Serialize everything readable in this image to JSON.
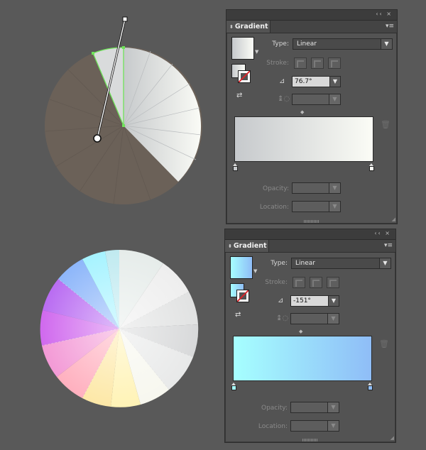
{
  "panels": [
    {
      "title": "Gradient",
      "type_label": "Type:",
      "type_value": "Linear",
      "stroke_label": "Stroke:",
      "angle_value": "76.7°",
      "opacity_label": "Opacity:",
      "location_label": "Location:",
      "colors": {
        "start": "#c6c9cc",
        "end": "#fbfcf6",
        "swatch": "#d6d9da"
      }
    },
    {
      "title": "Gradient",
      "type_label": "Type:",
      "type_value": "Linear",
      "stroke_label": "Stroke:",
      "angle_value": "-151°",
      "opacity_label": "Opacity:",
      "location_label": "Location:",
      "colors": {
        "start": "#a6ffff",
        "end": "#8fbdf7",
        "swatch": "#9de3fb"
      }
    }
  ],
  "icons": {
    "collapse": "double-chevron-left-icon",
    "close": "close-icon",
    "panel_menu": "panel-menu-icon",
    "angle": "angle-icon",
    "aspect_ratio": "aspect-ratio-icon",
    "delete_stop": "trash-icon",
    "reverse": "reverse-gradient-icon"
  },
  "artwork": {
    "top_wheel": {
      "base_color": "#6b6158",
      "highlight": "#6fe35a"
    },
    "bottom_wheel": {
      "colors": [
        "#b2f6ff",
        "#88b4f8",
        "#c34ef0",
        "#ef8ccf",
        "#ff9fb0",
        "#fdeea4",
        "#f5f5f5",
        "#c8cacb"
      ]
    }
  }
}
